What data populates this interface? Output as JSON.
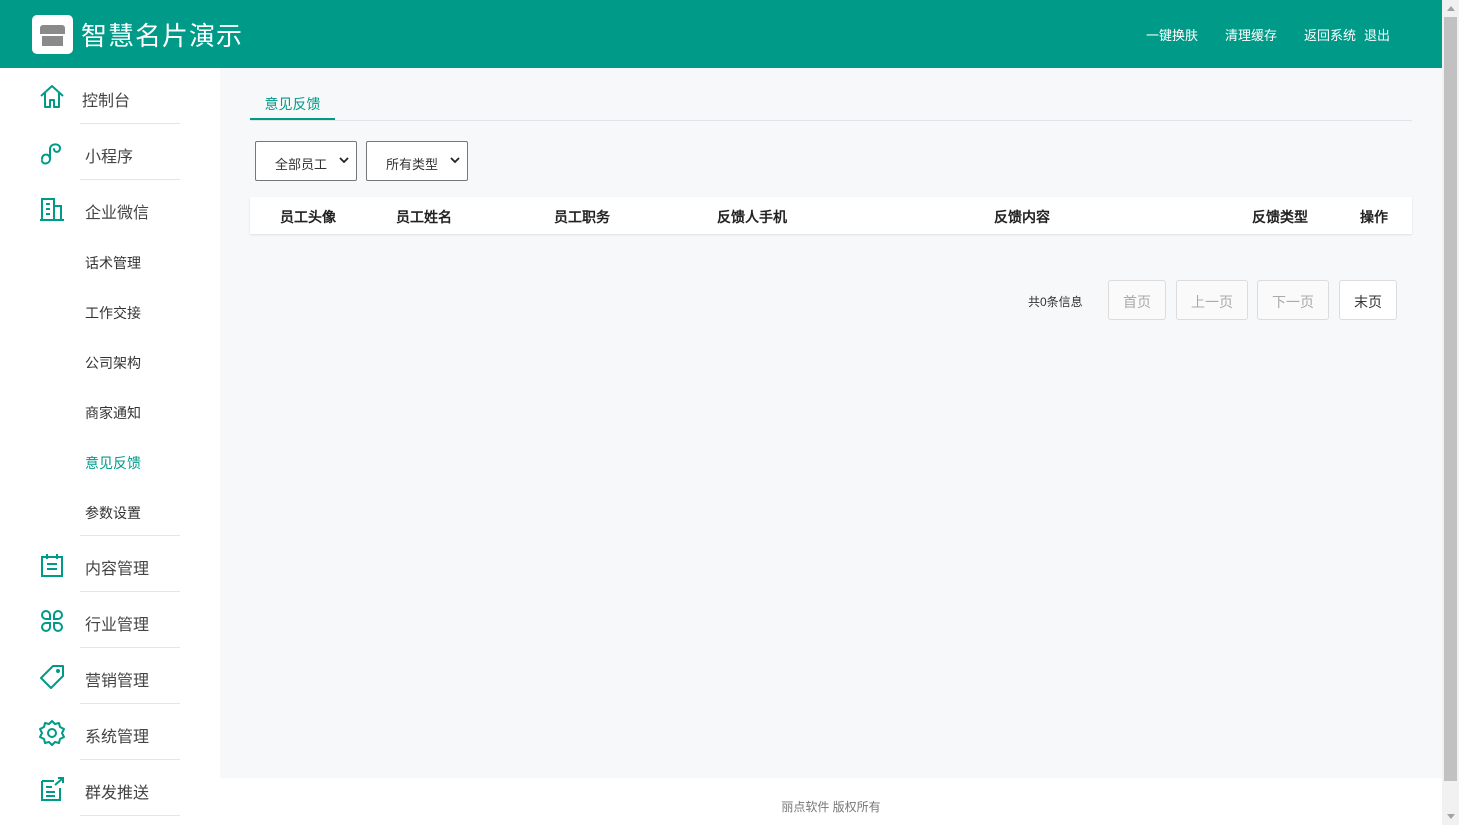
{
  "header": {
    "title": "智慧名片演示",
    "links": [
      "一键换肤",
      "清理缓存",
      "返回系统",
      "退出"
    ]
  },
  "sidebar": {
    "items": [
      {
        "label": "控制台",
        "icon": "home-icon"
      },
      {
        "label": "小程序",
        "icon": "miniprogram-icon"
      },
      {
        "label": "企业微信",
        "icon": "building-icon"
      },
      {
        "label": "内容管理",
        "icon": "calendar-icon"
      },
      {
        "label": "行业管理",
        "icon": "clover-icon"
      },
      {
        "label": "营销管理",
        "icon": "tag-icon"
      },
      {
        "label": "系统管理",
        "icon": "gear-icon"
      },
      {
        "label": "群发推送",
        "icon": "push-icon"
      }
    ],
    "sub_items": [
      "话术管理",
      "工作交接",
      "公司架构",
      "商家通知",
      "意见反馈",
      "参数设置"
    ],
    "active_sub": "意见反馈"
  },
  "main": {
    "tab": "意见反馈",
    "filters": {
      "employee": "全部员工",
      "type": "所有类型"
    },
    "table": {
      "columns": [
        "员工头像",
        "员工姓名",
        "员工职务",
        "反馈人手机",
        "反馈内容",
        "反馈类型",
        "操作"
      ],
      "rows": []
    },
    "pager": {
      "info": "共0条信息",
      "first": "首页",
      "prev": "上一页",
      "next": "下一页",
      "last": "末页"
    }
  },
  "footer": {
    "text": "丽点软件 版权所有"
  },
  "colors": {
    "accent": "#009a88",
    "background": "#f7f8fa"
  }
}
